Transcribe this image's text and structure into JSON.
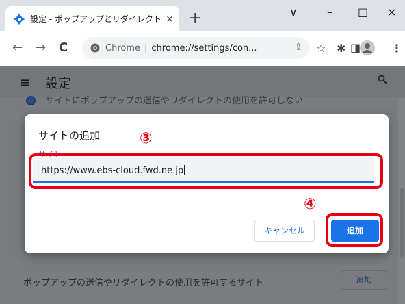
{
  "browser": {
    "tab_title": "設定 - ポップアップとリダイレクト",
    "tab_close": "×",
    "new_tab": "+",
    "window_controls": {
      "menu": "∨",
      "minimize": "–",
      "maximize": "□",
      "close": "×"
    },
    "back": "←",
    "forward": "→",
    "reload": "C",
    "address_origin": "Chrome",
    "address_separator": "|",
    "address_url": "chrome://settings/con...",
    "share": "⇪",
    "bookmark": "☆",
    "extensions": "✱",
    "sidepanel": "◨",
    "menu_dots": "⋮"
  },
  "settings": {
    "hamburger": "≡",
    "title": "設定",
    "search": "🔍",
    "behind_row_text": "サイトにポップアップの送信やリダイレクトの使用を許可しない",
    "list_title": "ポップアップの送信やリダイレクトの使用を許可するサイト",
    "list_add": "追加"
  },
  "dialog": {
    "title": "サイトの追加",
    "field_label": "サイト",
    "field_value": "https://www.ebs-cloud.fwd.ne.jp",
    "cancel_label": "キャンセル",
    "add_label": "追加"
  },
  "annotations": {
    "marker_3": "③",
    "marker_4": "④",
    "color": "#e60012"
  },
  "colors": {
    "accent": "#1a73e8",
    "overlay": "#7a7c7f"
  }
}
